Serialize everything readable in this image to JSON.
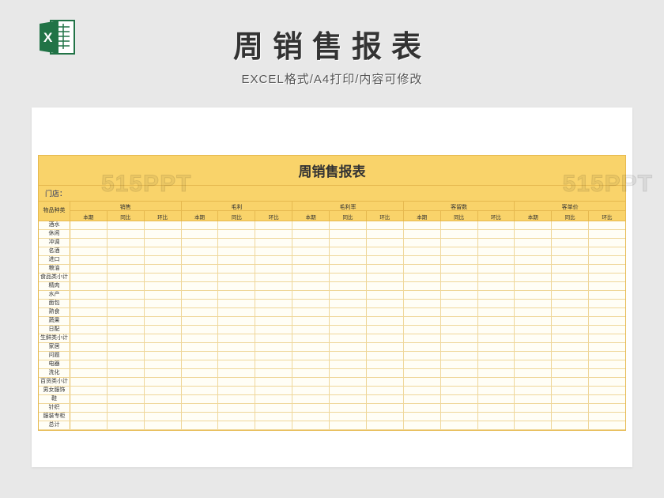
{
  "header": {
    "title": "周销售报表",
    "subtitle": "EXCEL格式/A4打印/内容可修改"
  },
  "watermark": "515PPT",
  "sheet": {
    "title": "周销售报表",
    "store_label": "门店：",
    "row_header": "物品种类",
    "metrics": [
      "销售",
      "毛利",
      "毛利率",
      "客留数",
      "客单价"
    ],
    "subcolumns": [
      "本期",
      "同比",
      "环比"
    ],
    "rows": [
      "酒水",
      "休闲",
      "冲调",
      "名酒",
      "进口",
      "粮油",
      "食品类小计",
      "精肉",
      "水产",
      "面包",
      "熟食",
      "蔬果",
      "日配",
      "生鲜类小计",
      "家居",
      "问题",
      "电器",
      "洗化",
      "百货类小计",
      "男女服饰",
      "鞋",
      "针织",
      "服装专柜",
      "总计"
    ]
  }
}
